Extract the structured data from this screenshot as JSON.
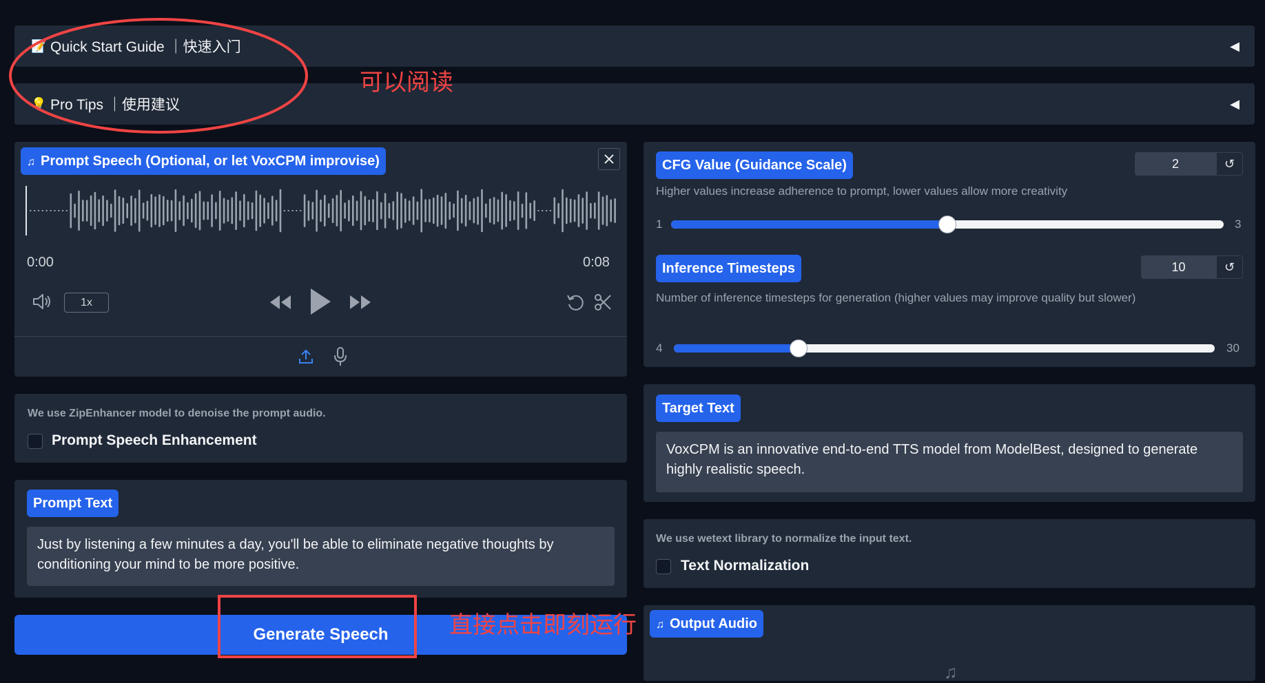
{
  "accordions": {
    "quick_start": {
      "icon": "memo-icon",
      "label": "Quick Start Guide ｜快速入门",
      "arrow": "◀"
    },
    "pro_tips": {
      "icon": "lightbulb-icon",
      "label": "Pro Tips ｜使用建议",
      "arrow": "◀"
    }
  },
  "annotations": {
    "read_note": "可以阅读",
    "click_note": "直接点击即刻运行"
  },
  "prompt_speech": {
    "label": "Prompt Speech (Optional, or let VoxCPM improvise)",
    "time_start": "0:00",
    "time_end": "0:08",
    "playback_rate": "1x"
  },
  "denoise": {
    "hint": "We use ZipEnhancer model to denoise the prompt audio.",
    "checkbox_label": "Prompt Speech Enhancement",
    "checked": false
  },
  "prompt_text": {
    "label": "Prompt Text",
    "value": "Just by listening a few minutes a day, you'll be able to eliminate negative thoughts by conditioning your mind to be more positive."
  },
  "generate_button": {
    "label": "Generate Speech"
  },
  "cfg": {
    "label": "CFG Value (Guidance Scale)",
    "description": "Higher values increase adherence to prompt, lower values allow more creativity",
    "value": "2",
    "min": "1",
    "max": "3",
    "level": 0.5
  },
  "timesteps": {
    "label": "Inference Timesteps",
    "description": "Number of inference timesteps for generation (higher values may improve quality but slower)",
    "value": "10",
    "min": "4",
    "max": "30",
    "level": 0.2308
  },
  "target_text": {
    "label": "Target Text",
    "value": "VoxCPM is an innovative end-to-end TTS model from ModelBest, designed to generate highly realistic speech."
  },
  "normalization": {
    "hint": "We use wetext library to normalize the input text.",
    "checkbox_label": "Text Normalization",
    "checked": false
  },
  "output_audio": {
    "label": "Output Audio"
  },
  "colors": {
    "accent": "#2563eb",
    "background": "#0b0f19",
    "panel": "#1f2937",
    "annotation": "#ef4444"
  }
}
